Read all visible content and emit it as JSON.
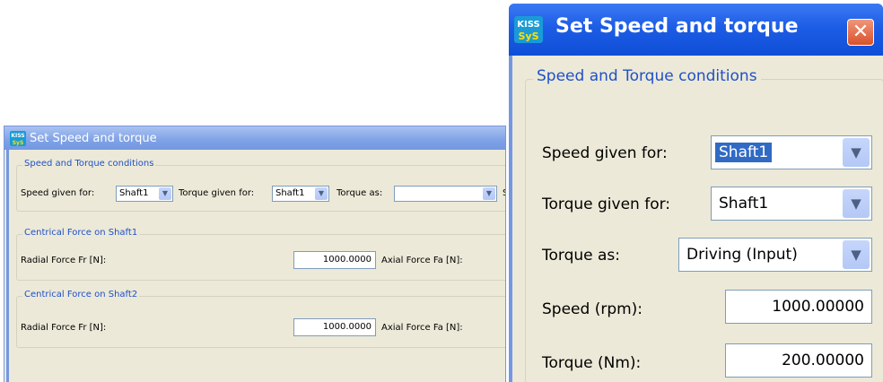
{
  "small_dialog": {
    "title": "Set Speed and torque",
    "speed_torque": {
      "legend": "Speed and Torque conditions",
      "speed_label": "Speed given for:",
      "speed_value": "Shaft1",
      "torque_label": "Torque given for:",
      "torque_value": "Shaft1",
      "torque_as_label": "Torque as:",
      "torque_as_value": "",
      "cut_label": "S"
    },
    "shaft1": {
      "legend": "Centrical Force on Shaft1",
      "radial_label": "Radial Force Fr [N]:",
      "radial_value": "1000.0000",
      "axial_label": "Axial Force Fa [N]:"
    },
    "shaft2": {
      "legend": "Centrical Force on Shaft2",
      "radial_label": "Radial Force Fr [N]:",
      "radial_value": "1000.0000",
      "axial_label": "Axial Force Fa [N]:"
    }
  },
  "big_dialog": {
    "title": "Set Speed and torque",
    "legend": "Speed and Torque conditions",
    "speed_label": "Speed given for:",
    "speed_value": "Shaft1",
    "torque_label": "Torque given for:",
    "torque_value": "Shaft1",
    "torque_as_label": "Torque as:",
    "torque_as_value": "Driving (Input)",
    "speed_rpm_label": "Speed (rpm):",
    "speed_rpm_value": "1000.00000",
    "torque_nm_label": "Torque (Nm):",
    "torque_nm_value": "200.00000"
  },
  "icons": {
    "logo": "kisssys-logo",
    "close": "close-icon",
    "dropdown": "chevron-down-icon"
  },
  "colors": {
    "title_blue": "#1d5de6",
    "legend_blue": "#1f50c8",
    "dialog_bg": "#ece9d8",
    "close_red": "#d8532c"
  }
}
